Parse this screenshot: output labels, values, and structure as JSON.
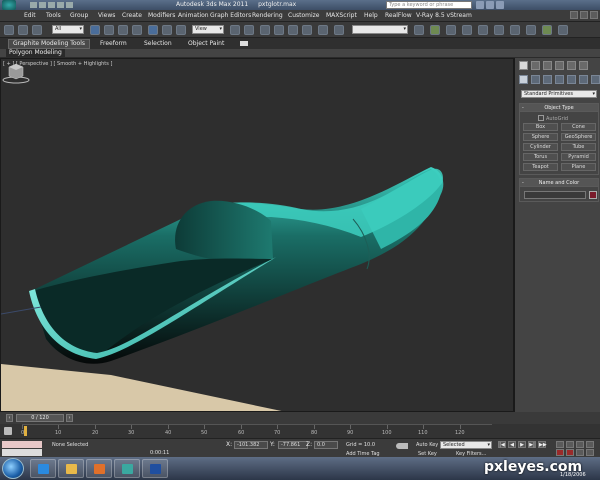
{
  "window": {
    "app_title": "Autodesk 3ds Max 2011",
    "file_name": "pxtglotr.max",
    "search_placeholder": "Type a keyword or phrase"
  },
  "menu": [
    {
      "label": "Edit"
    },
    {
      "label": "Tools"
    },
    {
      "label": "Group"
    },
    {
      "label": "Views"
    },
    {
      "label": "Create"
    },
    {
      "label": "Modifiers"
    },
    {
      "label": "Animation"
    },
    {
      "label": "Graph Editors"
    },
    {
      "label": "Rendering"
    },
    {
      "label": "Customize"
    },
    {
      "label": "MAXScript"
    },
    {
      "label": "Help"
    },
    {
      "label": "RealFlow"
    },
    {
      "label": "V-Ray 8.5 vStream"
    }
  ],
  "toolbar": {
    "selection_filter": "All",
    "reference_coord": "View"
  },
  "ribbon": {
    "tabs": [
      {
        "label": "Graphite Modeling Tools"
      },
      {
        "label": "Freeform"
      },
      {
        "label": "Selection"
      },
      {
        "label": "Object Paint"
      }
    ],
    "sub_label": "Polygon Modeling"
  },
  "viewport": {
    "label": "[ + ] [ Perspective ] [ Smooth + Highlights ]",
    "object_color": "#3bbfb3"
  },
  "command_panel": {
    "category": "Standard Primitives",
    "object_type_title": "Object Type",
    "autogrid_label": "AutoGrid",
    "primitives": [
      "Box",
      "Cone",
      "Sphere",
      "GeoSphere",
      "Cylinder",
      "Tube",
      "Torus",
      "Pyramid",
      "Teapot",
      "Plane"
    ],
    "name_color_title": "Name and Color",
    "color_swatch": "#7a1b2b"
  },
  "timeline": {
    "frame_slider": "0 / 120",
    "ticks": [
      "0",
      "10",
      "20",
      "30",
      "40",
      "50",
      "60",
      "70",
      "80",
      "90",
      "100",
      "110",
      "120"
    ]
  },
  "status": {
    "selection_text": "None Selected",
    "x_label": "X:",
    "x_value": "-101.382",
    "y_label": "Y:",
    "y_value": "-77.861",
    "z_label": "Z:",
    "z_value": "0.0",
    "grid_text": "Grid = 10.0",
    "add_time_tag": "Add Time Tag",
    "auto_key": "Auto Key",
    "selected_dropdown": "Selected",
    "set_key": "Set Key",
    "key_filters": "Key Filters...",
    "time_display": "0:00:11"
  },
  "taskbar": {
    "brand": "pxleyes.com",
    "date": "1/18/2006"
  }
}
